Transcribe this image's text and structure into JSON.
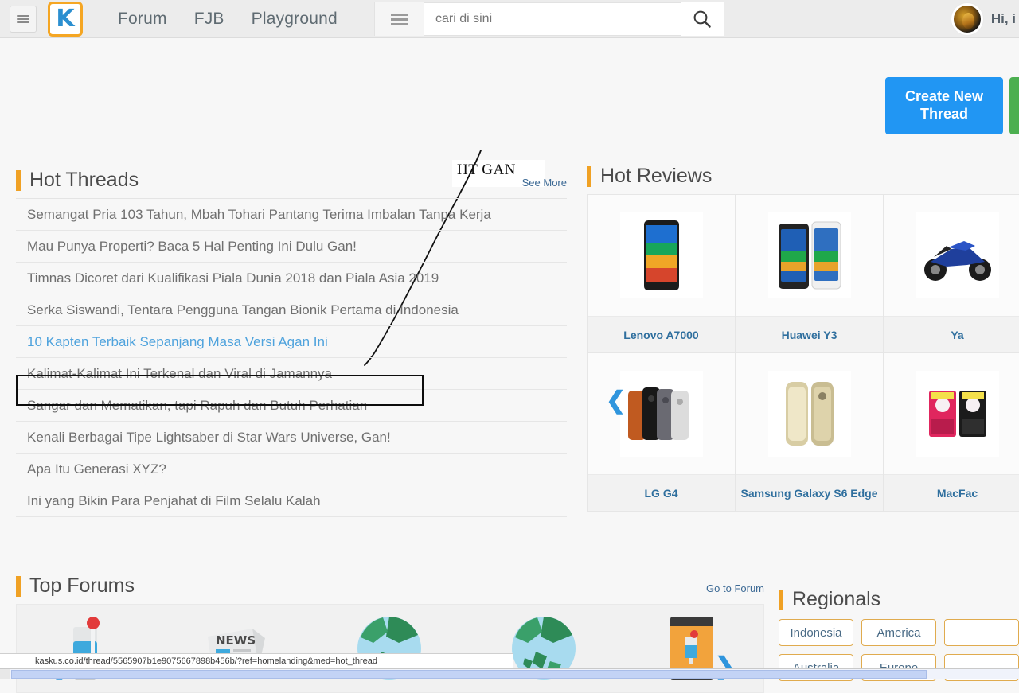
{
  "topbar": {
    "menu_icon": "hamburger-icon",
    "logo_text": "K",
    "nav": [
      {
        "label": "Forum"
      },
      {
        "label": "FJB"
      },
      {
        "label": "Playground"
      }
    ],
    "search": {
      "menu_icon": "list-menu-icon",
      "placeholder": "cari di sini",
      "value": "",
      "submit_icon": "search-icon"
    },
    "user": {
      "avatar_icon": "user-avatar",
      "greeting": "Hi, i"
    }
  },
  "actions": {
    "create_thread_label": "Create New Thread"
  },
  "annotation": {
    "label": "HT GAN"
  },
  "hot_threads": {
    "title": "Hot Threads",
    "see_more": "See More",
    "items": [
      {
        "label": "Semangat Pria 103 Tahun, Mbah Tohari Pantang Terima Imbalan Tanpa Kerja",
        "hovered": false
      },
      {
        "label": "Mau Punya Properti? Baca 5 Hal Penting Ini Dulu Gan!",
        "hovered": false
      },
      {
        "label": "Timnas Dicoret dari Kualifikasi Piala Dunia 2018 dan Piala Asia 2019",
        "hovered": false
      },
      {
        "label": "Serka Siswandi, Tentara Pengguna Tangan Bionik Pertama di Indonesia",
        "hovered": false
      },
      {
        "label": "10 Kapten Terbaik Sepanjang Masa Versi Agan Ini",
        "hovered": true
      },
      {
        "label": "Kalimat-Kalimat Ini Terkenal dan Viral di Jamannya",
        "hovered": false
      },
      {
        "label": "Sangar dan Mematikan, tapi Rapuh dan Butuh Perhatian",
        "hovered": false
      },
      {
        "label": "Kenali Berbagai Tipe Lightsaber di Star Wars Universe, Gan!",
        "hovered": false
      },
      {
        "label": "Apa Itu Generasi XYZ?",
        "hovered": false
      },
      {
        "label": "Ini yang Bikin Para Penjahat di Film Selalu Kalah",
        "hovered": false
      }
    ]
  },
  "hot_reviews": {
    "title": "Hot Reviews",
    "prev_icon": "chevron-left-icon",
    "items": [
      {
        "label": "Lenovo A7000",
        "art": "phone-green"
      },
      {
        "label": "Huawei Y3",
        "art": "phone-pair"
      },
      {
        "label": "Ya",
        "art": "motorbike"
      },
      {
        "label": "LG G4",
        "art": "phone-fan"
      },
      {
        "label": "Samsung Galaxy S6 Edge",
        "art": "phone-gold"
      },
      {
        "label": "MacFac",
        "art": "pack-red"
      }
    ]
  },
  "top_forums": {
    "title": "Top Forums",
    "go_to_forum": "Go to Forum",
    "prev_icon": "chevron-left-icon",
    "next_icon": "chevron-right-icon",
    "items": [
      {
        "icon": "cocktail-glass-icon"
      },
      {
        "icon": "newspaper-icon"
      },
      {
        "icon": "globe-icon"
      },
      {
        "icon": "globe-icon"
      },
      {
        "icon": "photo-frame-icon"
      }
    ]
  },
  "regionals": {
    "title": "Regionals",
    "items": [
      {
        "label": "Indonesia"
      },
      {
        "label": "America"
      },
      {
        "label": ""
      },
      {
        "label": "Australia"
      },
      {
        "label": "Europe"
      },
      {
        "label": ""
      }
    ]
  },
  "statusbar": {
    "url": "kaskus.co.id/thread/5565907b1e9075667898b456b/?ref=homelanding&med=hot_thread"
  },
  "colors": {
    "accent_orange": "#f0a124",
    "primary_blue": "#2196f3",
    "link_blue": "#2f6f9e",
    "logo_blue": "#2b8fd0",
    "green": "#4caf50"
  }
}
